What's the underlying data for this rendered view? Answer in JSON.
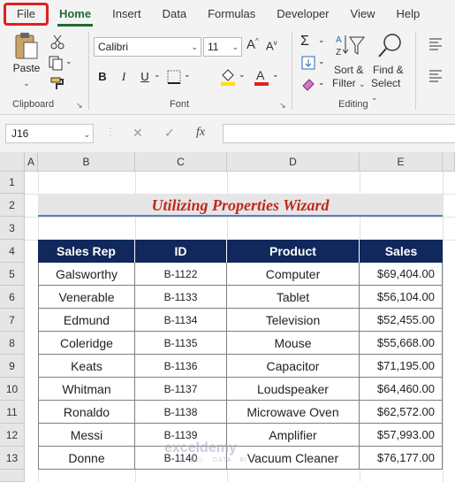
{
  "tabs": [
    "File",
    "Home",
    "Insert",
    "Data",
    "Formulas",
    "Developer",
    "View",
    "Help"
  ],
  "clipboard": {
    "paste_label": "Paste",
    "group_label": "Clipboard"
  },
  "font": {
    "name": "Calibri",
    "size": "11",
    "group_label": "Font",
    "bold": "B",
    "italic": "I",
    "underline": "U",
    "grow": "A",
    "shrink": "A"
  },
  "editing": {
    "sort_label_1": "Sort &",
    "sort_label_2": "Filter",
    "find_label_1": "Find &",
    "find_label_2": "Select",
    "group_label": "Editing"
  },
  "formula_bar": {
    "name_box": "J16",
    "fx": "fx"
  },
  "columns": [
    "A",
    "B",
    "C",
    "D",
    "E"
  ],
  "rows": [
    "1",
    "2",
    "3",
    "4",
    "5",
    "6",
    "7",
    "8",
    "9",
    "10",
    "11",
    "12",
    "13"
  ],
  "sheet": {
    "title": "Utilizing Properties Wizard",
    "headers": [
      "Sales Rep",
      "ID",
      "Product",
      "Sales"
    ],
    "data": [
      [
        "Galsworthy",
        "B-1122",
        "Computer",
        "$69,404.00"
      ],
      [
        "Venerable",
        "B-1133",
        "Tablet",
        "$56,104.00"
      ],
      [
        "Edmund",
        "B-1134",
        "Television",
        "$52,455.00"
      ],
      [
        "Coleridge",
        "B-1135",
        "Mouse",
        "$55,668.00"
      ],
      [
        "Keats",
        "B-1136",
        "Capacitor",
        "$71,195.00"
      ],
      [
        "Whitman",
        "B-1137",
        "Loudspeaker",
        "$64,460.00"
      ],
      [
        "Ronaldo",
        "B-1138",
        "Microwave Oven",
        "$62,572.00"
      ],
      [
        "Messi",
        "B-1139",
        "Amplifier",
        "$57,993.00"
      ],
      [
        "Donne",
        "B-1140",
        "Vacuum Cleaner",
        "$76,177.00"
      ]
    ]
  },
  "watermark": {
    "name": "exceldemy",
    "tagline": "EXCEL · DATA · BI"
  },
  "colors": {
    "accent_green": "#1e6b34",
    "header_navy": "#10285b",
    "title_red": "#c0281e",
    "highlight_red": "#e02020"
  }
}
